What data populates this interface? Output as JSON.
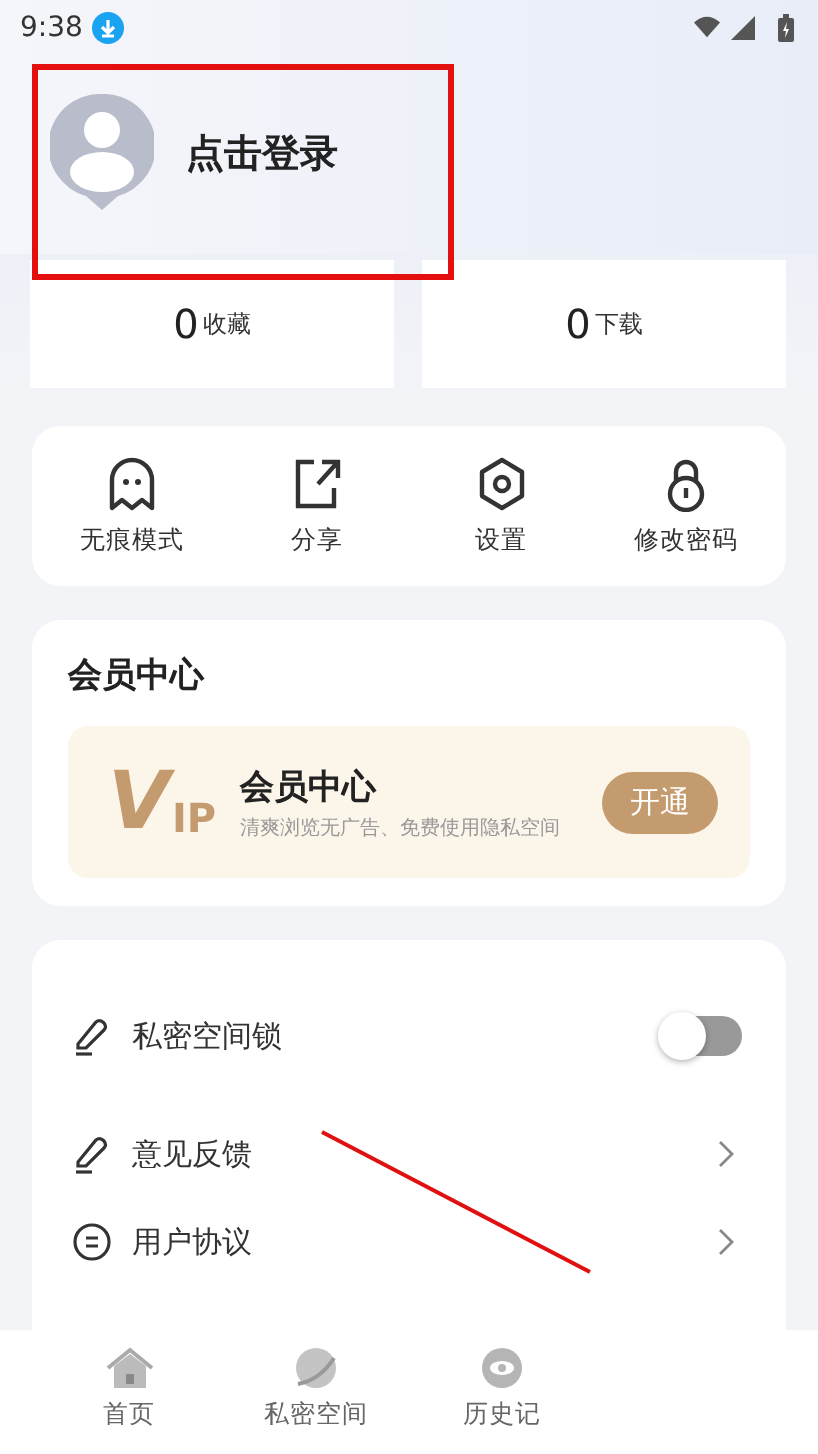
{
  "status_bar": {
    "time": "9:38"
  },
  "profile": {
    "login_label": "点击登录"
  },
  "stats": [
    {
      "count": "0",
      "label": "收藏"
    },
    {
      "count": "0",
      "label": "下载"
    }
  ],
  "quick_actions": [
    {
      "kind": "ghost",
      "label": "无痕模式"
    },
    {
      "kind": "share",
      "label": "分享"
    },
    {
      "kind": "settings",
      "label": "设置"
    },
    {
      "kind": "lock",
      "label": "修改密码"
    }
  ],
  "member": {
    "title": "会员中心",
    "banner_title": "会员中心",
    "banner_subtitle": "清爽浏览无广告、免费使用隐私空间",
    "vip_v": "V",
    "vip_ip": "IP",
    "button": "开通"
  },
  "settings": [
    {
      "kind": "toggle",
      "label": "私密空间锁",
      "on": false
    },
    {
      "kind": "link",
      "label": "意见反馈"
    },
    {
      "kind": "link",
      "label": "用户协议"
    }
  ],
  "bottom_nav": [
    {
      "kind": "home",
      "label": "首页"
    },
    {
      "kind": "planet",
      "label": "私密空间"
    },
    {
      "kind": "eye",
      "label": "历史记"
    }
  ]
}
